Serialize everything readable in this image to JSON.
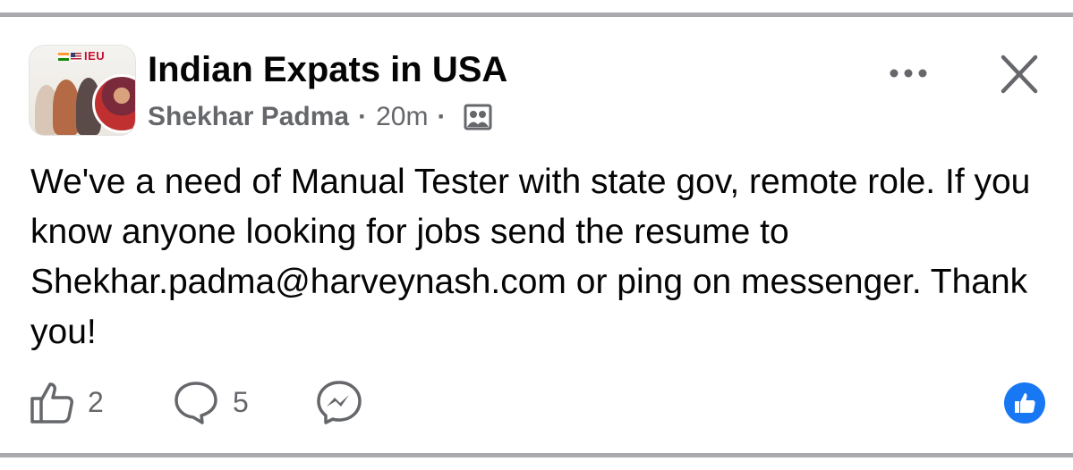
{
  "post": {
    "group_name": "Indian Expats in USA",
    "author": "Shekhar Padma",
    "separator": "·",
    "time": "20m",
    "avatar_badge": "IEU",
    "body": "We've a need of Manual Tester with state gov, remote role. If you know anyone looking for jobs send the resume to Shekhar.padma@harveynash.com or ping on messenger. Thank you!"
  },
  "actions": {
    "like_count": "2",
    "comment_count": "5"
  },
  "icons": {
    "more": "more-horizontal-icon",
    "close": "close-icon",
    "audience": "group-members-icon",
    "like": "thumbs-up-icon",
    "comment": "comment-bubble-icon",
    "messenger": "messenger-icon",
    "reaction": "like-reaction-icon"
  },
  "colors": {
    "text_primary": "#050505",
    "text_secondary": "#65676b",
    "accent_blue": "#1877f2",
    "divider": "#a9a9ae"
  }
}
